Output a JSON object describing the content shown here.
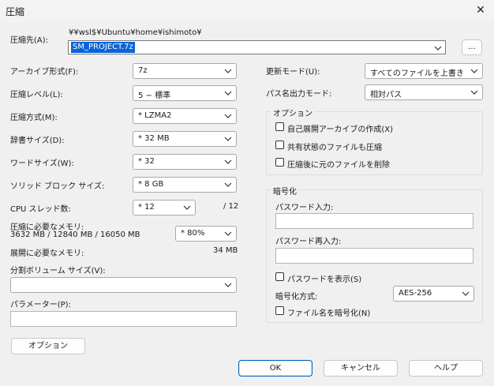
{
  "window": {
    "title": "圧縮",
    "close_glyph": "✕"
  },
  "archive": {
    "label": "圧縮先(A):",
    "path_prefix": "¥¥wsl$¥Ubuntu¥home¥ishimoto¥",
    "filename": "SM_PROJECT.7z",
    "browse_label": "..."
  },
  "left": {
    "format": {
      "label": "アーカイブ形式(F):",
      "value": "7z"
    },
    "level": {
      "label": "圧縮レベル(L):",
      "value": "5 − 標準"
    },
    "method": {
      "label": "圧縮方式(M):",
      "value": "* LZMA2"
    },
    "dict": {
      "label": "辞書サイズ(D):",
      "value": "* 32 MB"
    },
    "word": {
      "label": "ワードサイズ(W):",
      "value": "* 32"
    },
    "solid": {
      "label": "ソリッド ブロック サイズ:",
      "value": "* 8 GB"
    },
    "cpu": {
      "label": "CPU スレッド数:",
      "value": "* 12",
      "max": "/ 12"
    },
    "mem_compress": {
      "label": "圧縮に必要なメモリ:",
      "detail": "3632 MB / 12840 MB / 16050 MB",
      "value": "* 80%"
    },
    "mem_decompress": {
      "label": "展開に必要なメモリ:",
      "value": "34 MB"
    },
    "split": {
      "label": "分割ボリューム サイズ(V):",
      "value": ""
    },
    "params": {
      "label": "パラメーター(P):",
      "value": ""
    },
    "options_button": "オプション"
  },
  "right": {
    "update": {
      "label": "更新モード(U):",
      "value": "すべてのファイルを上書き"
    },
    "pathmode": {
      "label": "パス名出力モード:",
      "value": "相対パス"
    },
    "options_group": {
      "title": "オプション",
      "sfx": {
        "label": "自己展開アーカイブの作成(X)",
        "checked": false
      },
      "shared": {
        "label": "共有状態のファイルも圧縮",
        "checked": false
      },
      "delete": {
        "label": "圧縮後に元のファイルを削除",
        "checked": false
      }
    },
    "encryption": {
      "title": "暗号化",
      "password_label": "パスワード入力:",
      "password_value": "",
      "reenter_label": "パスワード再入力:",
      "reenter_value": "",
      "show_password": {
        "label": "パスワードを表示(S)",
        "checked": false
      },
      "method_label": "暗号化方式:",
      "method_value": "AES-256",
      "encrypt_names": {
        "label": "ファイル名を暗号化(N)",
        "checked": false
      }
    }
  },
  "footer": {
    "ok": "OK",
    "cancel": "キャンセル",
    "help": "ヘルプ"
  }
}
